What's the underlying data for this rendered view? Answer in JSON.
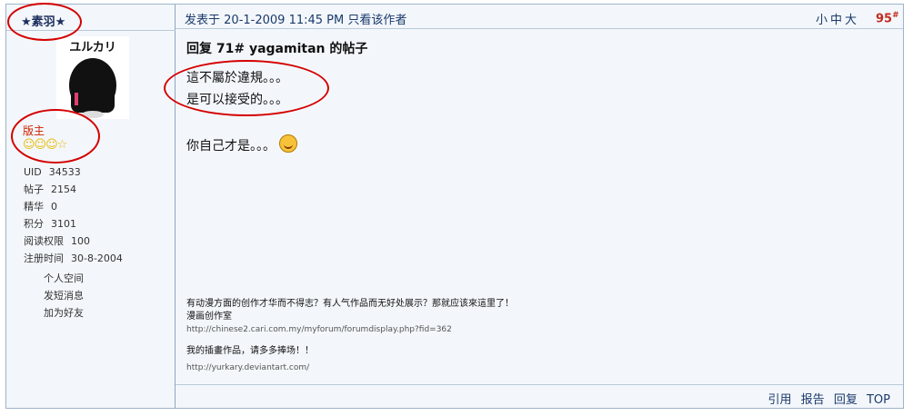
{
  "user": {
    "name": "★素羽★",
    "avatar_caption": "ユルカリ",
    "role": "版主",
    "stars": "☺☺☺☆",
    "stats": [
      {
        "label": "UID",
        "value": "34533"
      },
      {
        "label": "帖子",
        "value": "2154"
      },
      {
        "label": "精华",
        "value": "0"
      },
      {
        "label": "积分",
        "value": "3101"
      },
      {
        "label": "阅读权限",
        "value": "100"
      },
      {
        "label": "注册时间",
        "value": "30-8-2004"
      }
    ],
    "links": [
      "个人空间",
      "发短消息",
      "加为好友"
    ]
  },
  "post": {
    "posted_label": "发表于",
    "timestamp": "20-1-2009 11:45 PM",
    "only_author": "只看该作者",
    "font_sizes": [
      "小",
      "中",
      "大"
    ],
    "floor": "95",
    "floor_mark": "#",
    "title": "回复  71# yagamitan 的帖子",
    "lines": [
      "這不屬於違規。。。",
      "是可以接受的。。。"
    ],
    "line3": "你自己才是。。。",
    "signature": {
      "line1": "有动漫方面的创作才华而不得志？有人气作品而无好处展示？那就应该來這里了！",
      "line2": "漫画创作室",
      "url1": "http://chinese2.cari.com.my/myforum/forumdisplay.php?fid=362",
      "line3": "我的插畫作品，请多多捧场！！",
      "url2": "http://yurkary.deviantart.com/"
    },
    "actions": [
      "引用",
      "报告",
      "回复",
      "TOP"
    ]
  },
  "colors": {
    "annotation_red": "#d40000",
    "link_blue": "#1a3a6b",
    "floor_red": "#c32a1f"
  }
}
